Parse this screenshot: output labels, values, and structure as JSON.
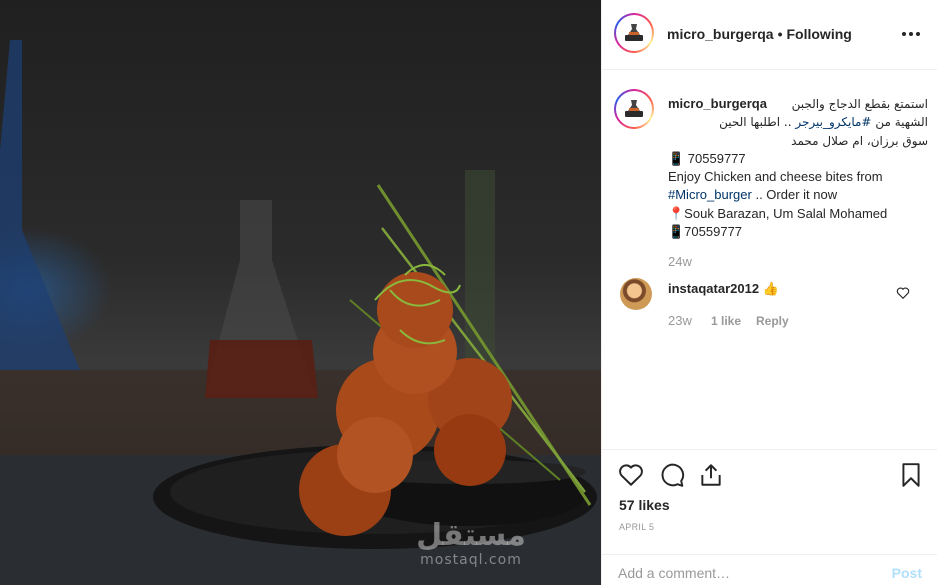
{
  "post": {
    "account": "micro_burgerqa",
    "separator": "•",
    "follow_status": "Following",
    "more_icon": "more-horizontal-icon",
    "caption": {
      "username": "micro_burgerqa",
      "lines": [
        "استمتع بقطع الدجاج والجبن",
        "الشهية من",
        "#مايكرو_بيرجر",
        ".. اطلبها الحين",
        "سوق برزان، ام صلال محمد",
        "📱 70559777",
        "Enjoy Chicken and cheese bites from",
        "#Micro_burger",
        ".. Order it now",
        "📍Souk Barazan, Um Salal Mohamed",
        "📱70559777"
      ],
      "time": "24w"
    },
    "comment": {
      "username": "instaqatar2012",
      "emoji": "👍",
      "time": "23w",
      "likes": "1 like",
      "reply": "Reply"
    },
    "likes": "57 likes",
    "date": "APRIL 5",
    "add_comment_placeholder": "Add a comment…",
    "post_button": "Post"
  },
  "watermark": {
    "arabic": "مستقل",
    "latin": "mostaql.com"
  },
  "colors": {
    "hashtag": "#003569",
    "muted": "#999999",
    "post_button": "#b2dffc",
    "text": "#262626"
  }
}
